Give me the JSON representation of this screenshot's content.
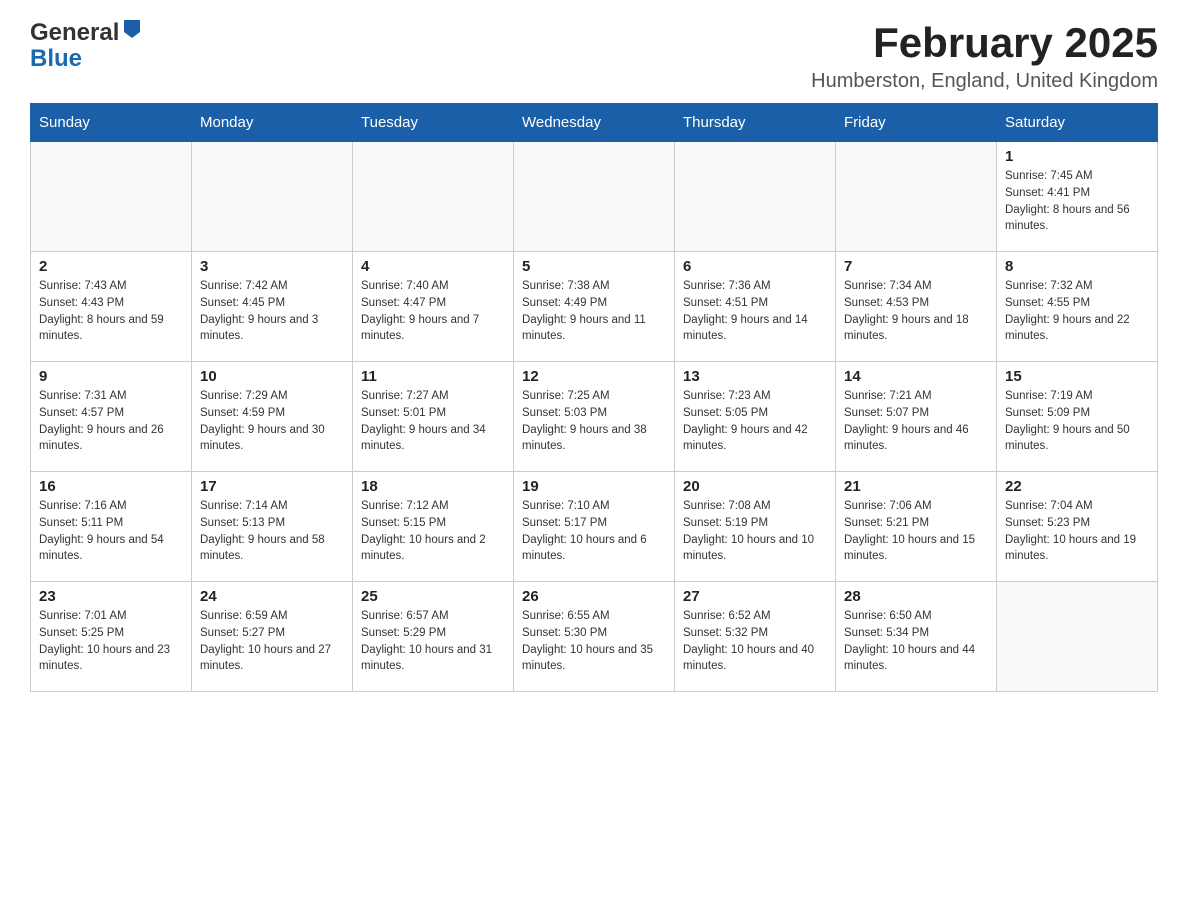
{
  "header": {
    "logo": {
      "general": "General",
      "blue": "Blue"
    },
    "title": "February 2025",
    "subtitle": "Humberston, England, United Kingdom"
  },
  "calendar": {
    "headers": [
      "Sunday",
      "Monday",
      "Tuesday",
      "Wednesday",
      "Thursday",
      "Friday",
      "Saturday"
    ],
    "rows": [
      [
        {
          "day": "",
          "info": ""
        },
        {
          "day": "",
          "info": ""
        },
        {
          "day": "",
          "info": ""
        },
        {
          "day": "",
          "info": ""
        },
        {
          "day": "",
          "info": ""
        },
        {
          "day": "",
          "info": ""
        },
        {
          "day": "1",
          "info": "Sunrise: 7:45 AM\nSunset: 4:41 PM\nDaylight: 8 hours and 56 minutes."
        }
      ],
      [
        {
          "day": "2",
          "info": "Sunrise: 7:43 AM\nSunset: 4:43 PM\nDaylight: 8 hours and 59 minutes."
        },
        {
          "day": "3",
          "info": "Sunrise: 7:42 AM\nSunset: 4:45 PM\nDaylight: 9 hours and 3 minutes."
        },
        {
          "day": "4",
          "info": "Sunrise: 7:40 AM\nSunset: 4:47 PM\nDaylight: 9 hours and 7 minutes."
        },
        {
          "day": "5",
          "info": "Sunrise: 7:38 AM\nSunset: 4:49 PM\nDaylight: 9 hours and 11 minutes."
        },
        {
          "day": "6",
          "info": "Sunrise: 7:36 AM\nSunset: 4:51 PM\nDaylight: 9 hours and 14 minutes."
        },
        {
          "day": "7",
          "info": "Sunrise: 7:34 AM\nSunset: 4:53 PM\nDaylight: 9 hours and 18 minutes."
        },
        {
          "day": "8",
          "info": "Sunrise: 7:32 AM\nSunset: 4:55 PM\nDaylight: 9 hours and 22 minutes."
        }
      ],
      [
        {
          "day": "9",
          "info": "Sunrise: 7:31 AM\nSunset: 4:57 PM\nDaylight: 9 hours and 26 minutes."
        },
        {
          "day": "10",
          "info": "Sunrise: 7:29 AM\nSunset: 4:59 PM\nDaylight: 9 hours and 30 minutes."
        },
        {
          "day": "11",
          "info": "Sunrise: 7:27 AM\nSunset: 5:01 PM\nDaylight: 9 hours and 34 minutes."
        },
        {
          "day": "12",
          "info": "Sunrise: 7:25 AM\nSunset: 5:03 PM\nDaylight: 9 hours and 38 minutes."
        },
        {
          "day": "13",
          "info": "Sunrise: 7:23 AM\nSunset: 5:05 PM\nDaylight: 9 hours and 42 minutes."
        },
        {
          "day": "14",
          "info": "Sunrise: 7:21 AM\nSunset: 5:07 PM\nDaylight: 9 hours and 46 minutes."
        },
        {
          "day": "15",
          "info": "Sunrise: 7:19 AM\nSunset: 5:09 PM\nDaylight: 9 hours and 50 minutes."
        }
      ],
      [
        {
          "day": "16",
          "info": "Sunrise: 7:16 AM\nSunset: 5:11 PM\nDaylight: 9 hours and 54 minutes."
        },
        {
          "day": "17",
          "info": "Sunrise: 7:14 AM\nSunset: 5:13 PM\nDaylight: 9 hours and 58 minutes."
        },
        {
          "day": "18",
          "info": "Sunrise: 7:12 AM\nSunset: 5:15 PM\nDaylight: 10 hours and 2 minutes."
        },
        {
          "day": "19",
          "info": "Sunrise: 7:10 AM\nSunset: 5:17 PM\nDaylight: 10 hours and 6 minutes."
        },
        {
          "day": "20",
          "info": "Sunrise: 7:08 AM\nSunset: 5:19 PM\nDaylight: 10 hours and 10 minutes."
        },
        {
          "day": "21",
          "info": "Sunrise: 7:06 AM\nSunset: 5:21 PM\nDaylight: 10 hours and 15 minutes."
        },
        {
          "day": "22",
          "info": "Sunrise: 7:04 AM\nSunset: 5:23 PM\nDaylight: 10 hours and 19 minutes."
        }
      ],
      [
        {
          "day": "23",
          "info": "Sunrise: 7:01 AM\nSunset: 5:25 PM\nDaylight: 10 hours and 23 minutes."
        },
        {
          "day": "24",
          "info": "Sunrise: 6:59 AM\nSunset: 5:27 PM\nDaylight: 10 hours and 27 minutes."
        },
        {
          "day": "25",
          "info": "Sunrise: 6:57 AM\nSunset: 5:29 PM\nDaylight: 10 hours and 31 minutes."
        },
        {
          "day": "26",
          "info": "Sunrise: 6:55 AM\nSunset: 5:30 PM\nDaylight: 10 hours and 35 minutes."
        },
        {
          "day": "27",
          "info": "Sunrise: 6:52 AM\nSunset: 5:32 PM\nDaylight: 10 hours and 40 minutes."
        },
        {
          "day": "28",
          "info": "Sunrise: 6:50 AM\nSunset: 5:34 PM\nDaylight: 10 hours and 44 minutes."
        },
        {
          "day": "",
          "info": ""
        }
      ]
    ]
  }
}
